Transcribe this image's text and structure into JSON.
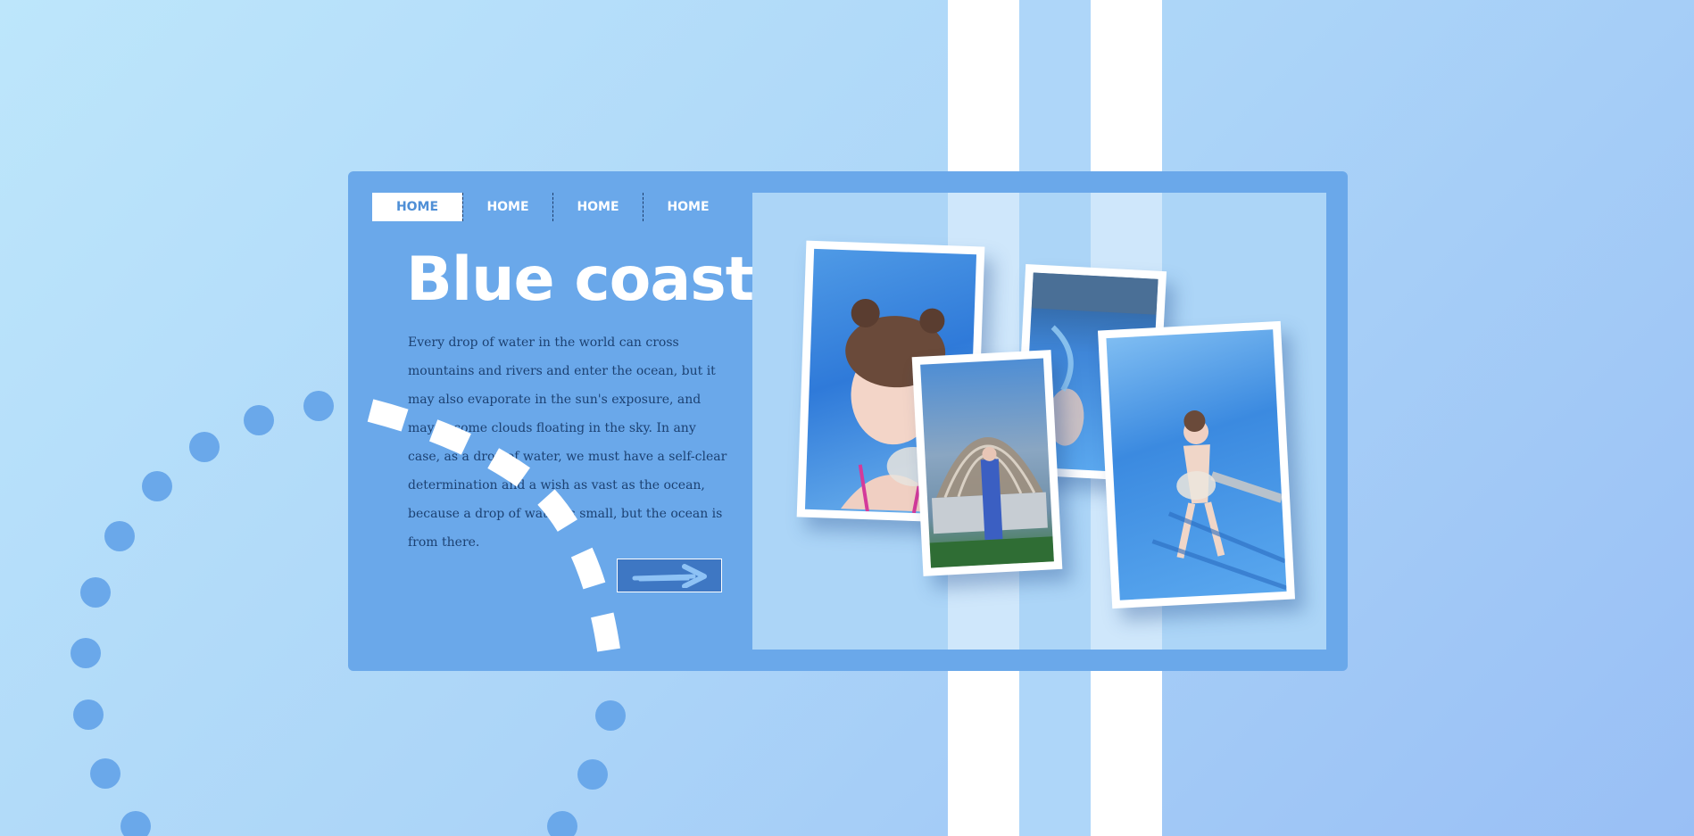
{
  "nav": {
    "items": [
      {
        "label": "HOME",
        "active": true
      },
      {
        "label": "HOME",
        "active": false
      },
      {
        "label": "HOME",
        "active": false
      },
      {
        "label": "HOME",
        "active": false
      }
    ]
  },
  "hero": {
    "title": "Blue coast",
    "body": "Every drop of water in the world can cross mountains and rivers and enter the ocean, but it may also evaporate in the sun's exposure, and may become clouds floating in the sky. In any case, as a drop of water, we must have a self-clear determination and a wish as vast as the ocean, because a drop of water is small, but the ocean is from there.",
    "cta_icon": "arrow-right-icon"
  },
  "gallery": {
    "photos": [
      "poolside-portrait-photo",
      "pool-edge-photo",
      "garden-cabana-photo",
      "swimming-pool-photo"
    ]
  },
  "colors": {
    "background": "#b3dcf9",
    "card": "#6aa8ea",
    "gallery_bg": "#acd5f7",
    "text_dark": "#1c4172",
    "button": "#3e77c3",
    "dots": "#6aa8ea",
    "white": "#ffffff"
  }
}
